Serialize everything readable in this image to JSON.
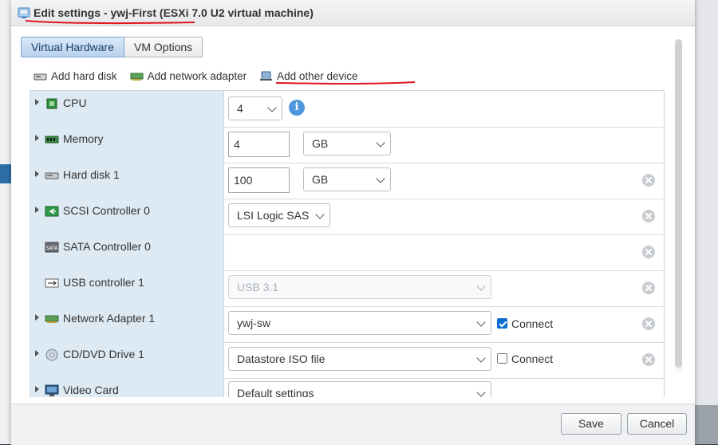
{
  "dialog": {
    "title": "Edit settings - ywj-First (ESXi 7.0 U2 virtual machine)"
  },
  "tabs": [
    {
      "label": "Virtual Hardware",
      "active": true
    },
    {
      "label": "VM Options",
      "active": false
    }
  ],
  "toolbar": {
    "add_hard_disk": "Add hard disk",
    "add_network_adapter": "Add network adapter",
    "add_other_device": "Add other device"
  },
  "devices": {
    "cpu": {
      "label": "CPU",
      "value": "4"
    },
    "memory": {
      "label": "Memory",
      "value": "4",
      "unit": "GB"
    },
    "hard_disk": {
      "label": "Hard disk 1",
      "value": "100",
      "unit": "GB"
    },
    "scsi": {
      "label": "SCSI Controller 0",
      "value": "LSI Logic SAS"
    },
    "sata": {
      "label": "SATA Controller 0"
    },
    "usb": {
      "label": "USB controller 1",
      "value": "USB 3.1"
    },
    "network": {
      "label": "Network Adapter 1",
      "value": "ywj-sw",
      "connect_label": "Connect",
      "connected": true
    },
    "cdrom": {
      "label": "CD/DVD Drive 1",
      "value": "Datastore ISO file",
      "connect_label": "Connect",
      "connected": false
    },
    "video": {
      "label": "Video Card",
      "value": "Default settings"
    }
  },
  "footer": {
    "save_label": "Save",
    "cancel_label": "Cancel"
  },
  "colors": {
    "accent": "#4e97dc",
    "annotation": "#e0161f",
    "label_column": "#dde9f3"
  }
}
